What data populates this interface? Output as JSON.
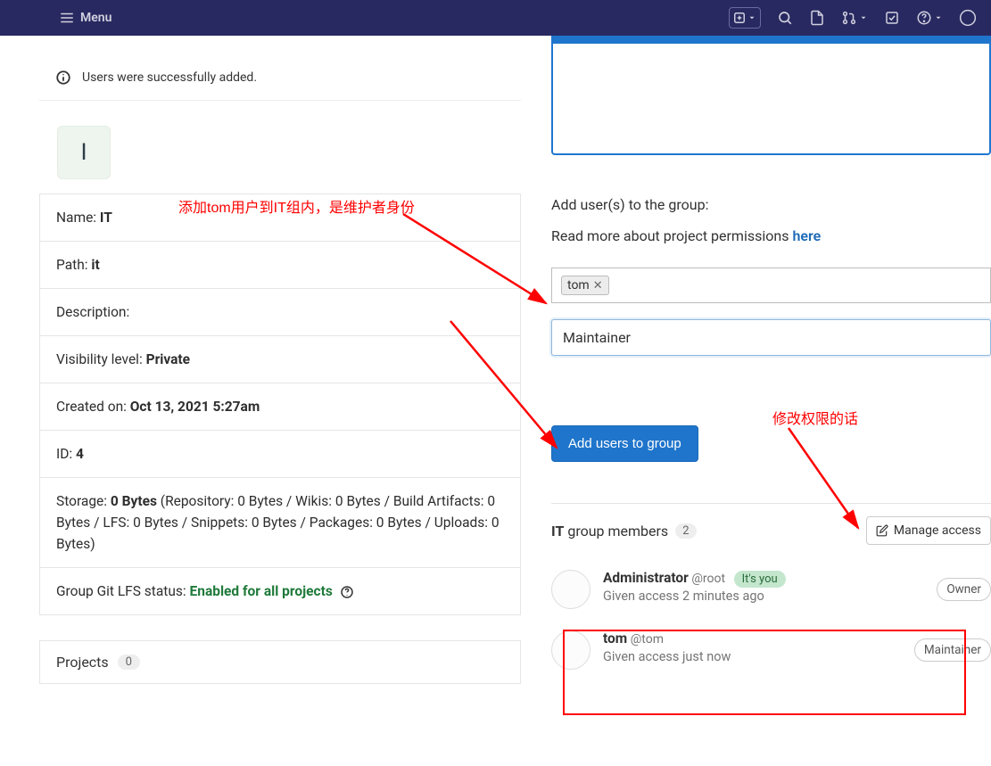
{
  "topbar": {
    "menu_label": "Menu"
  },
  "alert": {
    "text": "Users were successfully added."
  },
  "group": {
    "avatar_letter": "I",
    "name_label": "Name:",
    "name_value": "IT",
    "path_label": "Path:",
    "path_value": "it",
    "description_label": "Description:",
    "visibility_label": "Visibility level:",
    "visibility_value": "Private",
    "created_label": "Created on:",
    "created_value": "Oct 13, 2021 5:27am",
    "id_label": "ID:",
    "id_value": "4",
    "storage_label": "Storage:",
    "storage_value": "0 Bytes",
    "storage_breakdown": " (Repository: 0 Bytes / Wikis: 0 Bytes / Build Artifacts: 0 Bytes / LFS: 0 Bytes / Snippets: 0 Bytes / Packages: 0 Bytes / Uploads: 0 Bytes)",
    "lfs_label": "Group Git LFS status:",
    "lfs_value": "Enabled for all projects"
  },
  "projects": {
    "label": "Projects",
    "count": "0"
  },
  "right": {
    "heading": "Add user(s) to the group:",
    "perm_text": "Read more about project permissions ",
    "perm_link": "here",
    "token": "tom",
    "role": "Maintainer",
    "add_button": "Add users to group",
    "members_name": "IT",
    "members_title": " group members",
    "members_count": "2",
    "manage_label": "Manage access"
  },
  "members": [
    {
      "name": "Administrator",
      "handle": "@root",
      "you": "It's you",
      "meta": "Given access 2 minutes ago",
      "role": "Owner"
    },
    {
      "name": "tom",
      "handle": "@tom",
      "you": "",
      "meta": "Given access just now",
      "role": "Maintainer"
    }
  ],
  "annotations": {
    "text1": "添加tom用户到IT组内，是维护者身份",
    "text2": "修改权限的话"
  }
}
